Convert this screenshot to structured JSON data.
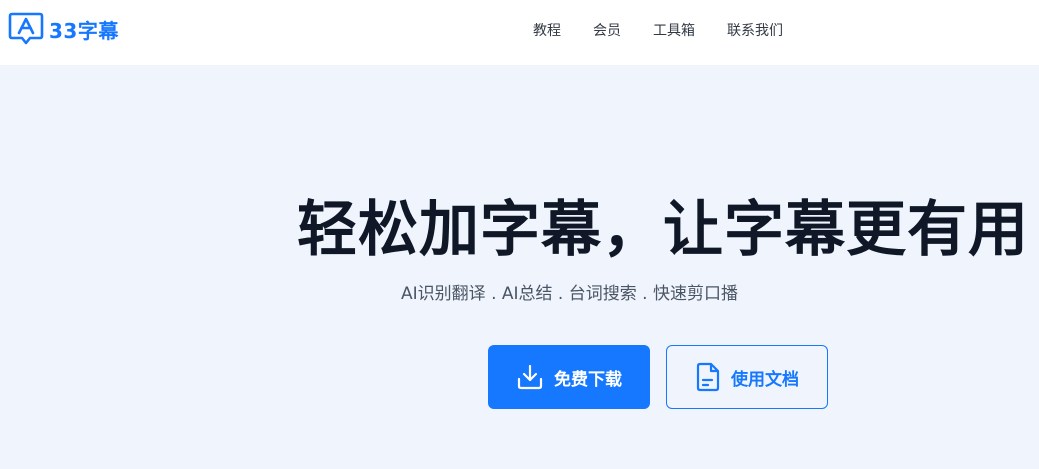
{
  "brand": {
    "name": "33字幕",
    "color": "#1677ff",
    "logo_icon": "subtitle-a-bubble-icon"
  },
  "nav": {
    "items": [
      {
        "label": "教程"
      },
      {
        "label": "会员"
      },
      {
        "label": "工具箱"
      },
      {
        "label": "联系我们"
      }
    ]
  },
  "hero": {
    "title": "轻松加字幕，让字幕更有用",
    "subtitle": "AI识别翻译 . AI总结 . 台词搜索 . 快速剪口播"
  },
  "buttons": {
    "download": {
      "label": "免费下载",
      "icon": "download-icon"
    },
    "docs": {
      "label": "使用文档",
      "icon": "document-icon"
    }
  },
  "colors": {
    "accent": "#1677ff",
    "page_bg": "#f0f5fd",
    "header_bg": "#ffffff",
    "title_text": "#101828"
  }
}
